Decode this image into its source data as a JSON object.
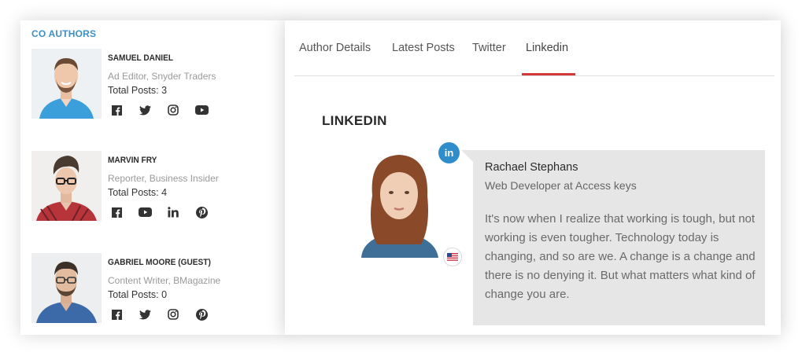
{
  "co_authors": {
    "title": "CO AUTHORS",
    "authors": [
      {
        "name": "SAMUEL DANIEL",
        "role": "Ad Editor, Snyder Traders",
        "posts": "Total Posts: 3",
        "social": [
          "facebook-icon",
          "twitter-icon",
          "instagram-icon",
          "youtube-icon"
        ]
      },
      {
        "name": "MARVIN FRY",
        "role": "Reporter, Business Insider",
        "posts": "Total Posts: 4",
        "social": [
          "facebook-icon",
          "youtube-icon",
          "linkedin-icon",
          "pinterest-icon"
        ]
      },
      {
        "name": "GABRIEL MOORE (GUEST)",
        "role": "Content Writer, BMagazine",
        "posts": "Total Posts: 0",
        "social": [
          "facebook-icon",
          "twitter-icon",
          "instagram-icon",
          "pinterest-icon"
        ]
      }
    ]
  },
  "tabs": [
    {
      "label": "Author Details"
    },
    {
      "label": "Latest Posts"
    },
    {
      "label": "Twitter"
    },
    {
      "label": "Linkedin",
      "active": true
    }
  ],
  "linkedin": {
    "section_title": "LINKEDIN",
    "badge": "in",
    "name": "Rachael Stephans",
    "role": "Web Developer at Access keys",
    "bio": "It's now when I realize that working is tough, but not working is even tougher. Technology today is changing, and so are we. A change is a change and there is no denying it. But what matters what kind of change you are."
  },
  "colors": {
    "accent_blue": "#3b8fc7",
    "tab_active": "#d23a3a",
    "linkedin_blue": "#2f8dcc",
    "bio_bg": "#e6e6e6"
  }
}
